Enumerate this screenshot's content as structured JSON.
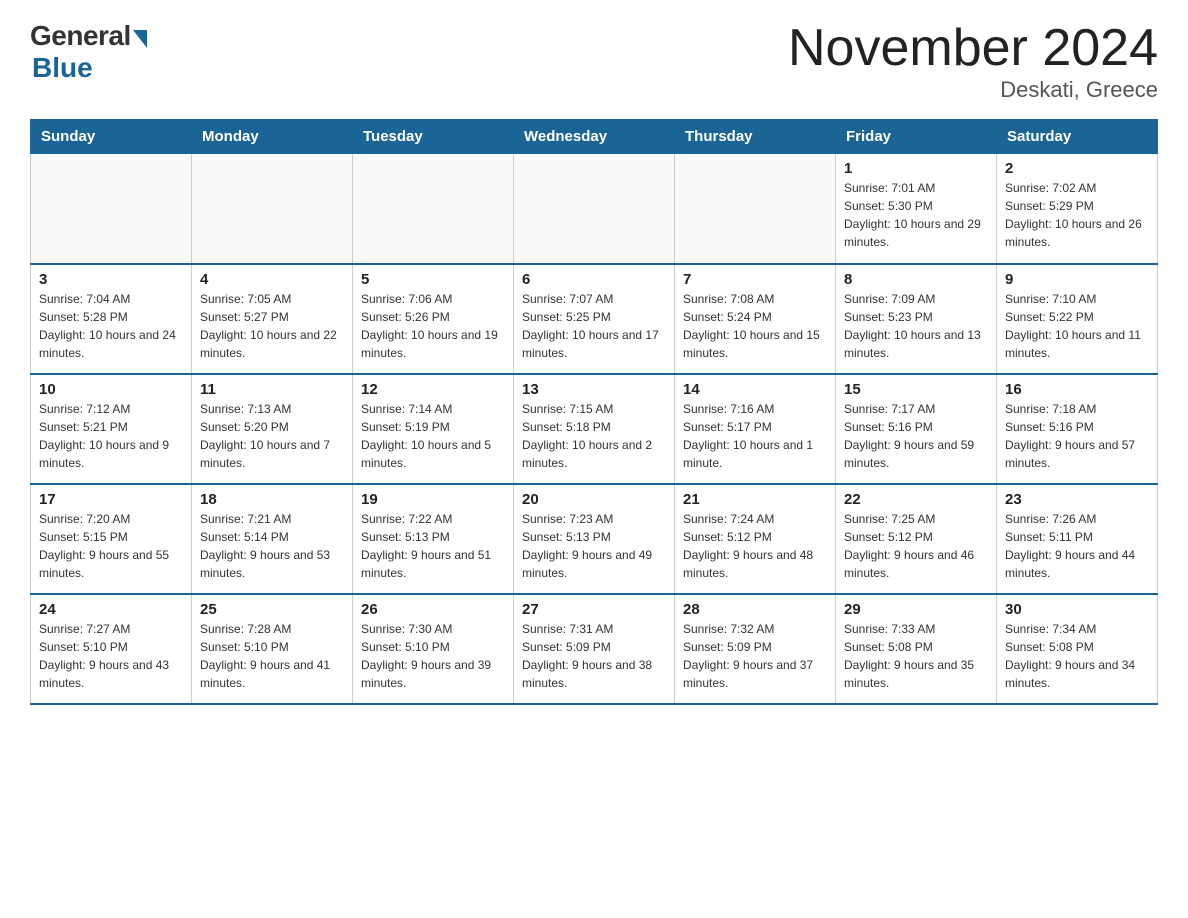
{
  "header": {
    "logo": {
      "general": "General",
      "blue": "Blue",
      "subtitle": ""
    },
    "title": "November 2024",
    "location": "Deskati, Greece"
  },
  "weekdays": [
    "Sunday",
    "Monday",
    "Tuesday",
    "Wednesday",
    "Thursday",
    "Friday",
    "Saturday"
  ],
  "weeks": [
    [
      {
        "day": "",
        "info": ""
      },
      {
        "day": "",
        "info": ""
      },
      {
        "day": "",
        "info": ""
      },
      {
        "day": "",
        "info": ""
      },
      {
        "day": "",
        "info": ""
      },
      {
        "day": "1",
        "info": "Sunrise: 7:01 AM\nSunset: 5:30 PM\nDaylight: 10 hours and 29 minutes."
      },
      {
        "day": "2",
        "info": "Sunrise: 7:02 AM\nSunset: 5:29 PM\nDaylight: 10 hours and 26 minutes."
      }
    ],
    [
      {
        "day": "3",
        "info": "Sunrise: 7:04 AM\nSunset: 5:28 PM\nDaylight: 10 hours and 24 minutes."
      },
      {
        "day": "4",
        "info": "Sunrise: 7:05 AM\nSunset: 5:27 PM\nDaylight: 10 hours and 22 minutes."
      },
      {
        "day": "5",
        "info": "Sunrise: 7:06 AM\nSunset: 5:26 PM\nDaylight: 10 hours and 19 minutes."
      },
      {
        "day": "6",
        "info": "Sunrise: 7:07 AM\nSunset: 5:25 PM\nDaylight: 10 hours and 17 minutes."
      },
      {
        "day": "7",
        "info": "Sunrise: 7:08 AM\nSunset: 5:24 PM\nDaylight: 10 hours and 15 minutes."
      },
      {
        "day": "8",
        "info": "Sunrise: 7:09 AM\nSunset: 5:23 PM\nDaylight: 10 hours and 13 minutes."
      },
      {
        "day": "9",
        "info": "Sunrise: 7:10 AM\nSunset: 5:22 PM\nDaylight: 10 hours and 11 minutes."
      }
    ],
    [
      {
        "day": "10",
        "info": "Sunrise: 7:12 AM\nSunset: 5:21 PM\nDaylight: 10 hours and 9 minutes."
      },
      {
        "day": "11",
        "info": "Sunrise: 7:13 AM\nSunset: 5:20 PM\nDaylight: 10 hours and 7 minutes."
      },
      {
        "day": "12",
        "info": "Sunrise: 7:14 AM\nSunset: 5:19 PM\nDaylight: 10 hours and 5 minutes."
      },
      {
        "day": "13",
        "info": "Sunrise: 7:15 AM\nSunset: 5:18 PM\nDaylight: 10 hours and 2 minutes."
      },
      {
        "day": "14",
        "info": "Sunrise: 7:16 AM\nSunset: 5:17 PM\nDaylight: 10 hours and 1 minute."
      },
      {
        "day": "15",
        "info": "Sunrise: 7:17 AM\nSunset: 5:16 PM\nDaylight: 9 hours and 59 minutes."
      },
      {
        "day": "16",
        "info": "Sunrise: 7:18 AM\nSunset: 5:16 PM\nDaylight: 9 hours and 57 minutes."
      }
    ],
    [
      {
        "day": "17",
        "info": "Sunrise: 7:20 AM\nSunset: 5:15 PM\nDaylight: 9 hours and 55 minutes."
      },
      {
        "day": "18",
        "info": "Sunrise: 7:21 AM\nSunset: 5:14 PM\nDaylight: 9 hours and 53 minutes."
      },
      {
        "day": "19",
        "info": "Sunrise: 7:22 AM\nSunset: 5:13 PM\nDaylight: 9 hours and 51 minutes."
      },
      {
        "day": "20",
        "info": "Sunrise: 7:23 AM\nSunset: 5:13 PM\nDaylight: 9 hours and 49 minutes."
      },
      {
        "day": "21",
        "info": "Sunrise: 7:24 AM\nSunset: 5:12 PM\nDaylight: 9 hours and 48 minutes."
      },
      {
        "day": "22",
        "info": "Sunrise: 7:25 AM\nSunset: 5:12 PM\nDaylight: 9 hours and 46 minutes."
      },
      {
        "day": "23",
        "info": "Sunrise: 7:26 AM\nSunset: 5:11 PM\nDaylight: 9 hours and 44 minutes."
      }
    ],
    [
      {
        "day": "24",
        "info": "Sunrise: 7:27 AM\nSunset: 5:10 PM\nDaylight: 9 hours and 43 minutes."
      },
      {
        "day": "25",
        "info": "Sunrise: 7:28 AM\nSunset: 5:10 PM\nDaylight: 9 hours and 41 minutes."
      },
      {
        "day": "26",
        "info": "Sunrise: 7:30 AM\nSunset: 5:10 PM\nDaylight: 9 hours and 39 minutes."
      },
      {
        "day": "27",
        "info": "Sunrise: 7:31 AM\nSunset: 5:09 PM\nDaylight: 9 hours and 38 minutes."
      },
      {
        "day": "28",
        "info": "Sunrise: 7:32 AM\nSunset: 5:09 PM\nDaylight: 9 hours and 37 minutes."
      },
      {
        "day": "29",
        "info": "Sunrise: 7:33 AM\nSunset: 5:08 PM\nDaylight: 9 hours and 35 minutes."
      },
      {
        "day": "30",
        "info": "Sunrise: 7:34 AM\nSunset: 5:08 PM\nDaylight: 9 hours and 34 minutes."
      }
    ]
  ]
}
